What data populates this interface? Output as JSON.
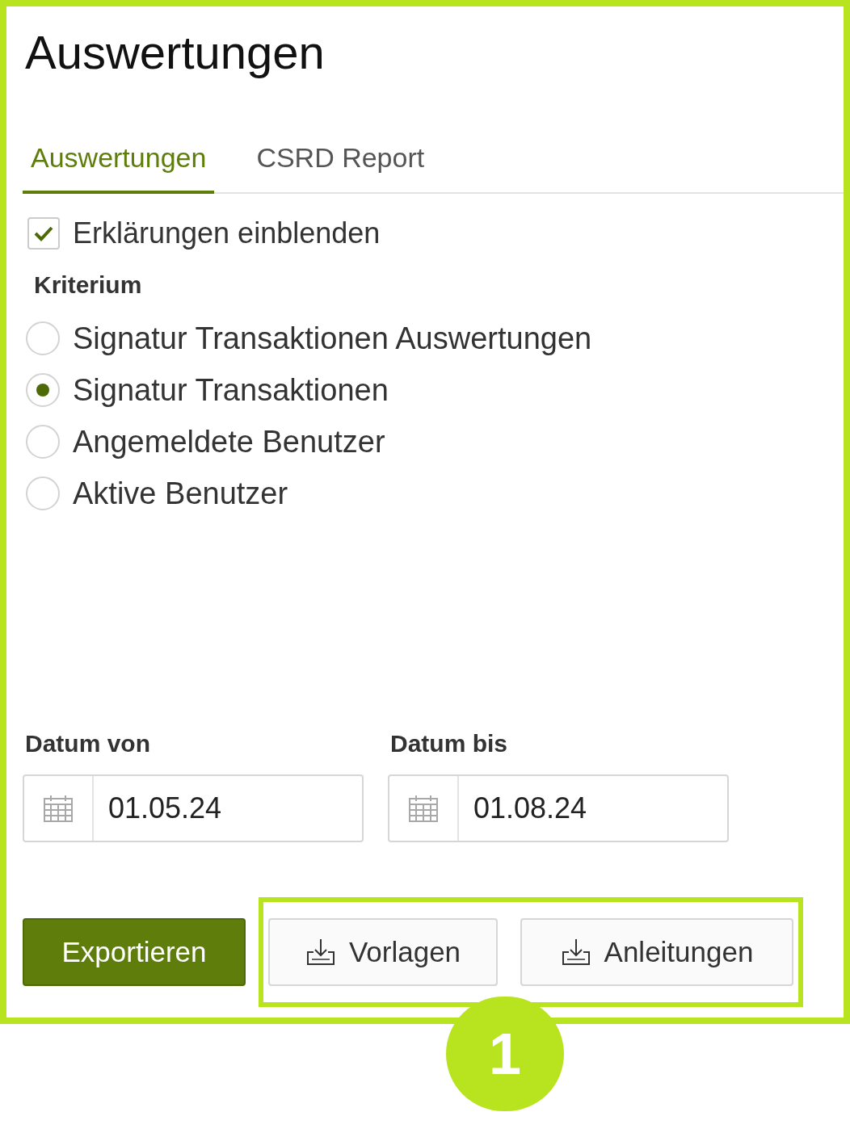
{
  "title": "Auswertungen",
  "tabs": [
    {
      "label": "Auswertungen",
      "selected": true
    },
    {
      "label": "CSRD Report",
      "selected": false
    }
  ],
  "show_explanations": {
    "label": "Erklärungen einblenden",
    "checked": true
  },
  "criterion": {
    "label": "Kriterium",
    "options": [
      {
        "label": "Signatur Transaktionen Auswertungen",
        "selected": false
      },
      {
        "label": "Signatur Transaktionen",
        "selected": true
      },
      {
        "label": "Angemeldete Benutzer",
        "selected": false
      },
      {
        "label": "Aktive Benutzer",
        "selected": false
      }
    ]
  },
  "dates": [
    {
      "label": "Datum von",
      "value": "01.05.24"
    },
    {
      "label": "Datum bis",
      "value": "01.08.24"
    }
  ],
  "buttons": [
    {
      "label": "Exportieren",
      "kind": "primary"
    },
    {
      "label": "Vorlagen",
      "kind": "download"
    },
    {
      "label": "Anleitungen",
      "kind": "download"
    }
  ],
  "callout": {
    "number": "1"
  }
}
